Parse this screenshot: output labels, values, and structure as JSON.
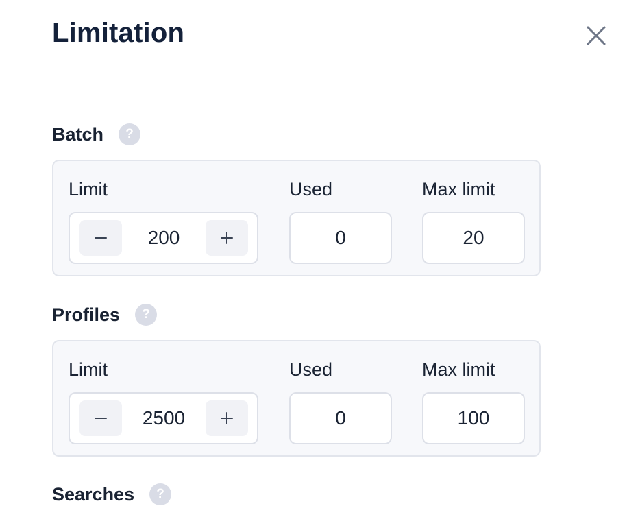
{
  "dialog": {
    "title": "Limitation",
    "close_icon": "close-icon"
  },
  "sections": {
    "batch": {
      "title": "Batch",
      "labels": {
        "limit": "Limit",
        "used": "Used",
        "max": "Max limit"
      },
      "limit": "200",
      "used": "0",
      "max_limit": "20",
      "minus": "−",
      "plus": "+"
    },
    "profiles": {
      "title": "Profiles",
      "labels": {
        "limit": "Limit",
        "used": "Used",
        "max": "Max limit"
      },
      "limit": "2500",
      "used": "0",
      "max_limit": "100",
      "minus": "−",
      "plus": "+"
    },
    "searches": {
      "title": "Searches"
    }
  },
  "help_glyph": "?",
  "colors": {
    "title": "#14213a",
    "text": "#1a2333",
    "card_bg": "#f7f8fb",
    "card_border": "#e2e5ec",
    "help_icon_bg": "#d9dce6",
    "close_icon": "#6e7687"
  }
}
